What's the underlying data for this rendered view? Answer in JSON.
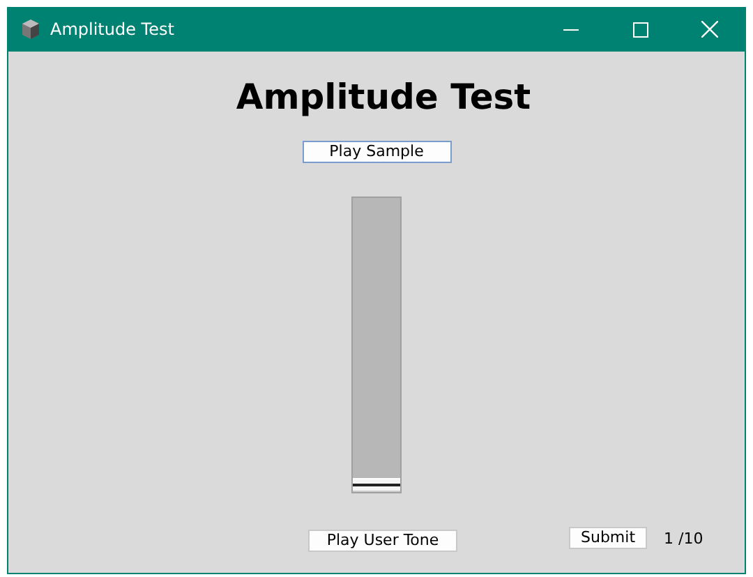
{
  "window": {
    "title": "Amplitude Test"
  },
  "heading": "Amplitude Test",
  "play_sample_button": "Play Sample",
  "slider": {
    "level": 0
  },
  "play_user_tone_button": "Play User Tone",
  "submit_button": "Submit",
  "progress": "1 /10"
}
